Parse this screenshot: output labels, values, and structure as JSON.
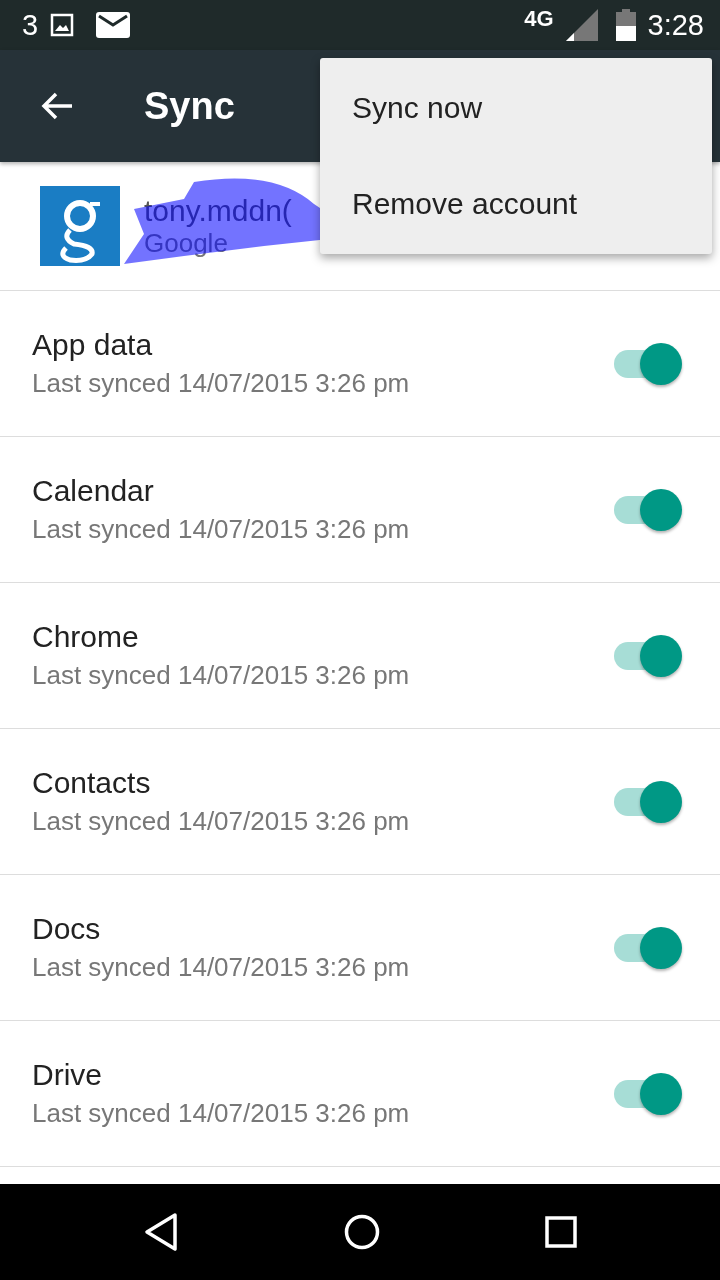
{
  "status_bar": {
    "notification_count": "3",
    "network": "4G",
    "time": "3:28"
  },
  "toolbar": {
    "title": "Sync"
  },
  "account": {
    "email": "tony.mddn(",
    "type": "Google"
  },
  "menu": {
    "items": [
      "Sync now",
      "Remove account"
    ]
  },
  "sync_items": [
    {
      "name": "App data",
      "status": "Last synced 14/07/2015 3:26 pm",
      "on": true
    },
    {
      "name": "Calendar",
      "status": "Last synced 14/07/2015 3:26 pm",
      "on": true
    },
    {
      "name": "Chrome",
      "status": "Last synced 14/07/2015 3:26 pm",
      "on": true
    },
    {
      "name": "Contacts",
      "status": "Last synced 14/07/2015 3:26 pm",
      "on": true
    },
    {
      "name": "Docs",
      "status": "Last synced 14/07/2015 3:26 pm",
      "on": true
    },
    {
      "name": "Drive",
      "status": "Last synced 14/07/2015 3:26 pm",
      "on": true
    }
  ]
}
